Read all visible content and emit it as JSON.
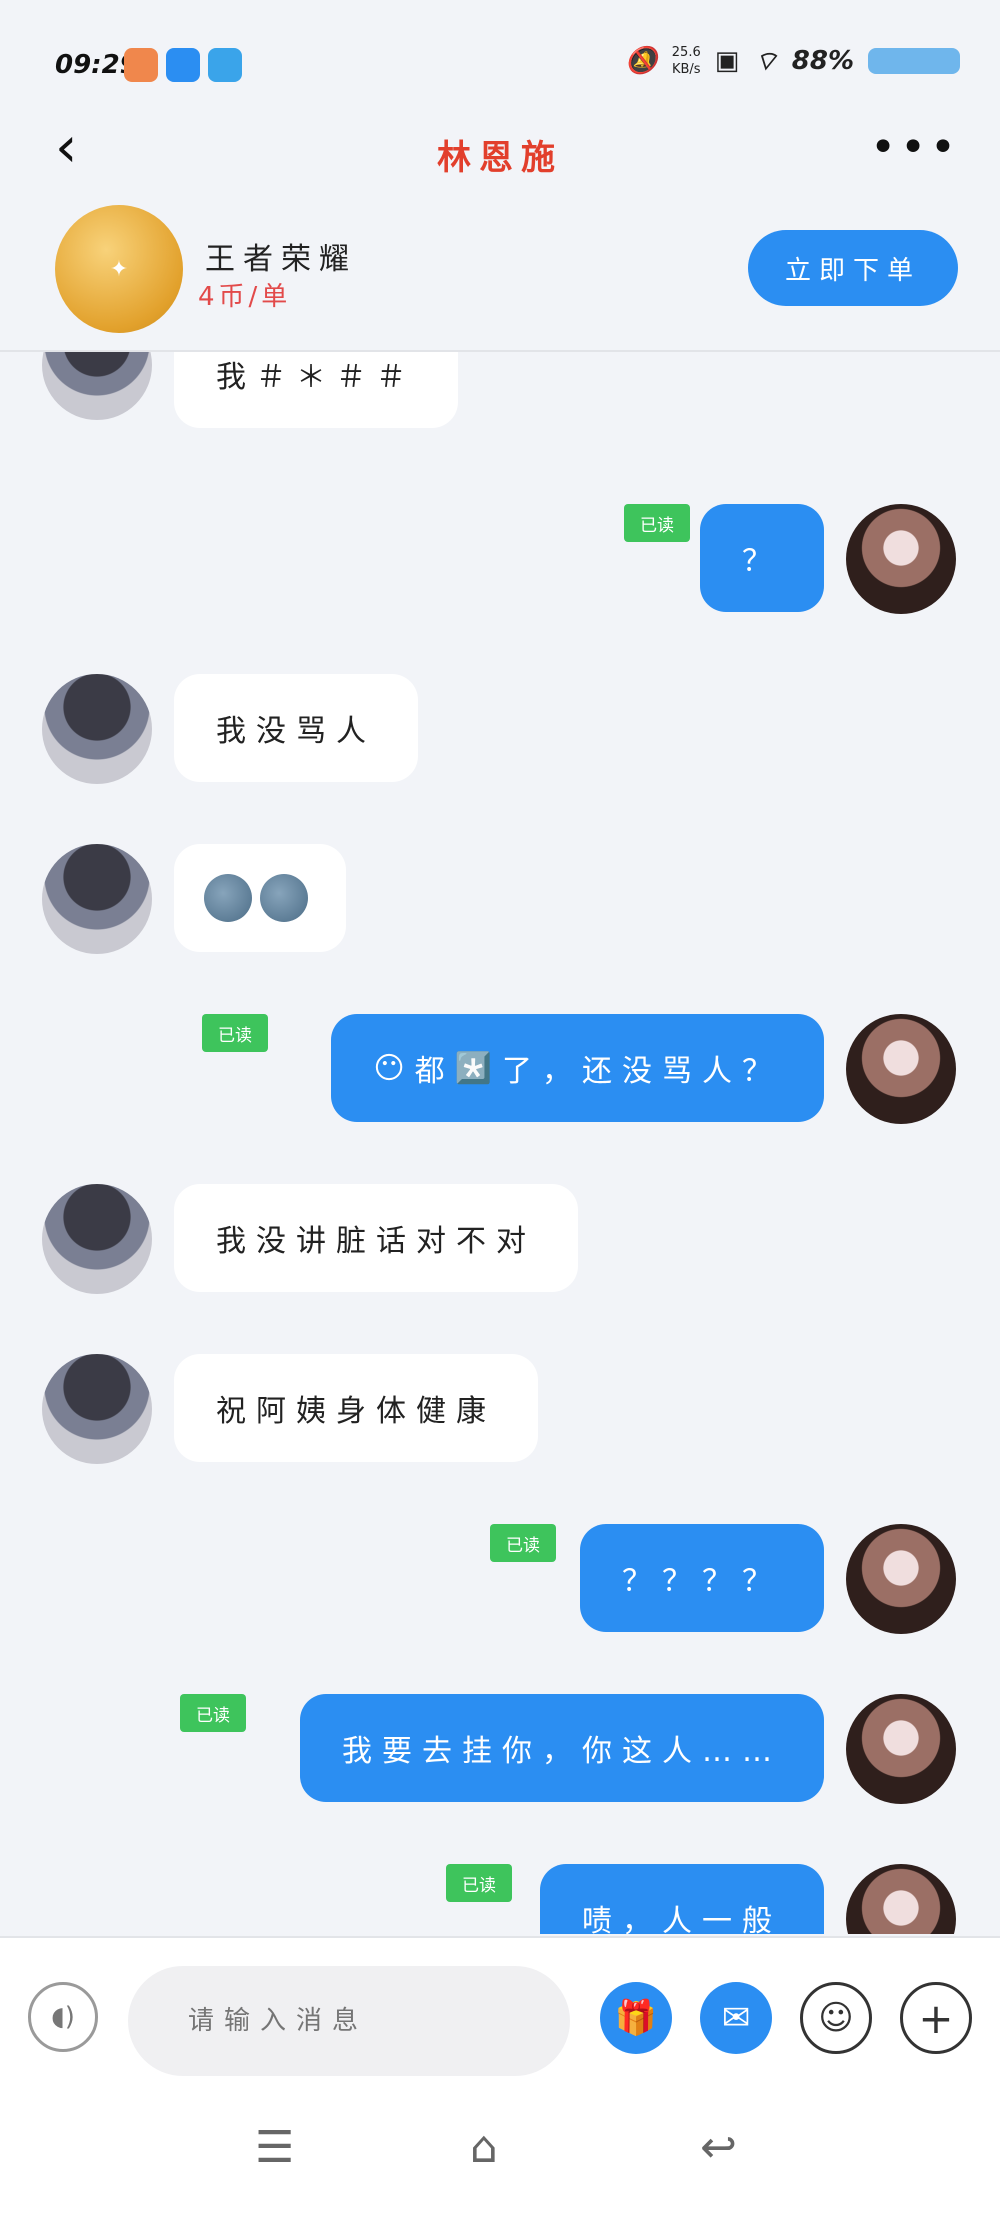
{
  "status_bar": {
    "time": "09:29",
    "net_speed_value": "25.6",
    "net_speed_unit": "KB/s",
    "battery": "88%"
  },
  "header": {
    "title": "林恩施"
  },
  "product": {
    "game_name": "王者荣耀",
    "price": "4币/单",
    "order_button": "立即下单"
  },
  "read_label": "已读",
  "messages": [
    {
      "from": "them",
      "text": "我＃＊＃＃"
    },
    {
      "from": "me",
      "text": "？",
      "read": true
    },
    {
      "from": "them",
      "text": "我没骂人"
    },
    {
      "from": "them",
      "emoji": "moon-face-x2"
    },
    {
      "from": "me",
      "text_parts": [
        "😶",
        "都",
        "*️⃣",
        "了，还没骂人？"
      ],
      "read": true
    },
    {
      "from": "them",
      "text": "我没讲脏话对不对"
    },
    {
      "from": "them",
      "text": "祝阿姨身体健康"
    },
    {
      "from": "me",
      "text": "？？？？",
      "read": true
    },
    {
      "from": "me",
      "text": "我要去挂你，你这人……",
      "read": true
    },
    {
      "from": "me",
      "text": "啧，人一般",
      "read": true
    }
  ],
  "input": {
    "placeholder": "请输入消息"
  },
  "icons": {
    "back": "back-arrow-icon",
    "more": "more-dots-icon",
    "voice": "voice-icon",
    "gift": "gift-icon",
    "red_packet": "red-packet-icon",
    "emoji": "emoji-icon",
    "plus": "plus-icon"
  },
  "colors": {
    "accent": "#2b8ef2",
    "read_badge": "#3ec45c",
    "title": "#e23f2c",
    "price": "#e24a4a"
  }
}
